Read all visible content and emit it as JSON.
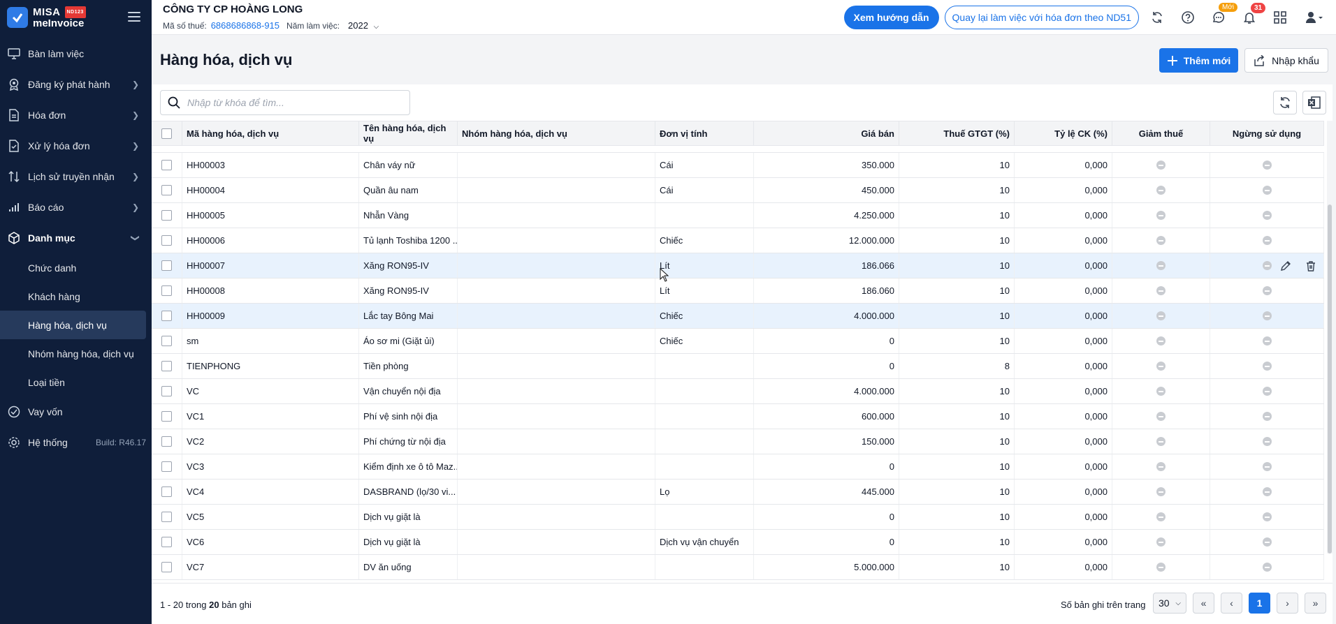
{
  "sidebar": {
    "brand": {
      "line1": "MISA",
      "badge": "ND123",
      "line2": "meInvoice"
    },
    "items": [
      {
        "label": "Bàn làm việc",
        "chevron": false
      },
      {
        "label": "Đăng ký phát hành",
        "chevron": true
      },
      {
        "label": "Hóa đơn",
        "chevron": true
      },
      {
        "label": "Xử lý hóa đơn",
        "chevron": true
      },
      {
        "label": "Lịch sử truyền nhận",
        "chevron": true
      },
      {
        "label": "Báo cáo",
        "chevron": true
      },
      {
        "label": "Danh mục",
        "chevron": true
      }
    ],
    "submenu": [
      "Chức danh",
      "Khách hàng",
      "Hàng hóa, dịch vụ",
      "Nhóm hàng hóa, dịch vụ",
      "Loại tiền"
    ],
    "loan": "Vay vốn",
    "system": "Hệ thống",
    "build": "Build: R46.17"
  },
  "header": {
    "company": "CÔNG TY CP HOÀNG LONG",
    "tax_label": "Mã số thuế:",
    "tax_code": "6868686868-915",
    "year_label": "Năm làm việc:",
    "year": "2022",
    "guide_btn": "Xem hướng dẫn",
    "back_btn": "Quay lại làm việc với hóa đơn theo ND51",
    "msg_badge": "Mới",
    "notif_count": "31"
  },
  "page": {
    "title": "Hàng hóa, dịch vụ",
    "add_btn": "Thêm mới",
    "import_btn": "Nhập khẩu",
    "search_placeholder": "Nhập từ khóa để tìm..."
  },
  "table": {
    "columns": [
      "Mã hàng hóa, dịch vụ",
      "Tên hàng hóa, dịch vụ",
      "Nhóm hàng hóa, dịch vụ",
      "Đơn vị tính",
      "Giá bán",
      "Thuế GTGT (%)",
      "Tỷ lệ CK (%)",
      "Giảm thuế",
      "Ngừng sử dụng"
    ],
    "rows": [
      {
        "code": "HH00003",
        "name": "Chân váy nữ",
        "group": "",
        "unit": "Cái",
        "price": "350.000",
        "vat": "10",
        "disc": "0,000"
      },
      {
        "code": "HH00004",
        "name": "Quần âu nam",
        "group": "",
        "unit": "Cái",
        "price": "450.000",
        "vat": "10",
        "disc": "0,000"
      },
      {
        "code": "HH00005",
        "name": "Nhẫn Vàng",
        "group": "",
        "unit": "",
        "price": "4.250.000",
        "vat": "10",
        "disc": "0,000"
      },
      {
        "code": "HH00006",
        "name": "Tủ lạnh Toshiba 1200 ...",
        "group": "",
        "unit": "Chiếc",
        "price": "12.000.000",
        "vat": "10",
        "disc": "0,000"
      },
      {
        "code": "HH00007",
        "name": "Xăng RON95-IV",
        "group": "",
        "unit": "Lít",
        "price": "186.066",
        "vat": "10",
        "disc": "0,000"
      },
      {
        "code": "HH00008",
        "name": "Xăng RON95-IV",
        "group": "",
        "unit": "Lít",
        "price": "186.060",
        "vat": "10",
        "disc": "0,000"
      },
      {
        "code": "HH00009",
        "name": "Lắc tay Bông Mai",
        "group": "",
        "unit": "Chiếc",
        "price": "4.000.000",
        "vat": "10",
        "disc": "0,000"
      },
      {
        "code": "sm",
        "name": "Áo sơ mi (Giặt ủi)",
        "group": "",
        "unit": "Chiếc",
        "price": "0",
        "vat": "10",
        "disc": "0,000"
      },
      {
        "code": "TIENPHONG",
        "name": "Tiền phòng",
        "group": "",
        "unit": "",
        "price": "0",
        "vat": "8",
        "disc": "0,000"
      },
      {
        "code": "VC",
        "name": "Vận chuyển nội địa",
        "group": "",
        "unit": "",
        "price": "4.000.000",
        "vat": "10",
        "disc": "0,000"
      },
      {
        "code": "VC1",
        "name": "Phí vệ sinh nội địa",
        "group": "",
        "unit": "",
        "price": "600.000",
        "vat": "10",
        "disc": "0,000"
      },
      {
        "code": "VC2",
        "name": "Phí chứng từ nội địa",
        "group": "",
        "unit": "",
        "price": "150.000",
        "vat": "10",
        "disc": "0,000"
      },
      {
        "code": "VC3",
        "name": "Kiểm định xe ô tô Maz...",
        "group": "",
        "unit": "",
        "price": "0",
        "vat": "10",
        "disc": "0,000"
      },
      {
        "code": "VC4",
        "name": "DASBRAND (lọ/30 vi...",
        "group": "",
        "unit": "Lọ",
        "price": "445.000",
        "vat": "10",
        "disc": "0,000"
      },
      {
        "code": "VC5",
        "name": "Dịch vụ giặt là",
        "group": "",
        "unit": "",
        "price": "0",
        "vat": "10",
        "disc": "0,000"
      },
      {
        "code": "VC6",
        "name": "Dịch vụ giặt là",
        "group": "",
        "unit": "Dịch vụ vận chuyển",
        "price": "0",
        "vat": "10",
        "disc": "0,000"
      },
      {
        "code": "VC7",
        "name": "DV ăn uống",
        "group": "",
        "unit": "",
        "price": "5.000.000",
        "vat": "10",
        "disc": "0,000"
      }
    ],
    "hover_row": 4,
    "selected_row": 6
  },
  "footer": {
    "range": "1 - 20 trong",
    "total": "20",
    "suffix": "bản ghi",
    "page_size_label": "Số bản ghi trên trang",
    "page_size": "30",
    "current_page": "1"
  },
  "colors": {
    "primary": "#1a73e8",
    "sidebar": "#0f1e3a",
    "hover_row": "#e8f2fd"
  }
}
